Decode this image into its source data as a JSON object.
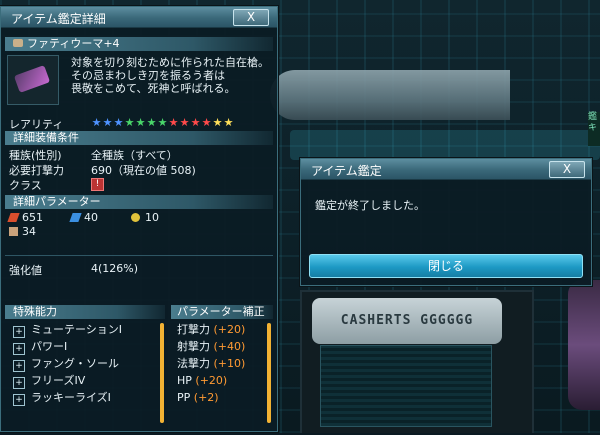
{
  "detail": {
    "title": "アイテム鑑定詳細",
    "close_label": "X",
    "item_name": "ファティウーマ+4",
    "description": [
      "対象を切り刻むために作られた自在槍。",
      "その忌まわしき刃を振るう者は",
      "畏敬をこめて、死神と呼ばれる。"
    ],
    "rarity_label": "レアリティ",
    "rarity_stars": 13,
    "rarity_colors": [
      "#4f93ff",
      "#4f93ff",
      "#4f93ff",
      "#49d66a",
      "#49d66a",
      "#49d66a",
      "#49d66a",
      "#ff4a4a",
      "#ff4a4a",
      "#ff4a4a",
      "#ff4a4a",
      "#ffe05a",
      "#ffe05a"
    ],
    "requirements_header": "詳細装備条件",
    "race_label": "種族(性別)",
    "race_value": "全種族（すべて）",
    "attack_label": "必要打撃力",
    "attack_value": "690（現在の値 508)",
    "class_label": "クラス",
    "params_header": "詳細パラメーター",
    "stat_attack": "651",
    "stat_range": "40",
    "stat_tech": "10",
    "stat_special": "34",
    "grind_label": "強化値",
    "grind_value": "4(126%)",
    "abilities_header": "特殊能力",
    "abilities": [
      "ミューテーションI",
      "パワーI",
      "ファング・ソール",
      "フリーズIV",
      "ラッキーライズI"
    ],
    "bonus_header": "パラメーター補正",
    "bonuses": [
      {
        "name": "打撃力",
        "value": "(+20)"
      },
      {
        "name": "射撃力",
        "value": "(+40)"
      },
      {
        "name": "法撃力",
        "value": "(+10)"
      },
      {
        "name": "HP",
        "value": "(+20)"
      },
      {
        "name": "PP",
        "value": "(+2)"
      }
    ]
  },
  "dialog": {
    "title": "アイテム鑑定",
    "close_label": "X",
    "message": "鑑定が終了しました。",
    "button_label": "閉じる"
  },
  "background": {
    "plate_text": "CASHERTS GGGGGG",
    "sign_text": "鑑キ"
  },
  "colors": {
    "accent": "#1d99c4",
    "bonus_value": "#ff9a33",
    "scroll_thumb": "#f2b233"
  }
}
